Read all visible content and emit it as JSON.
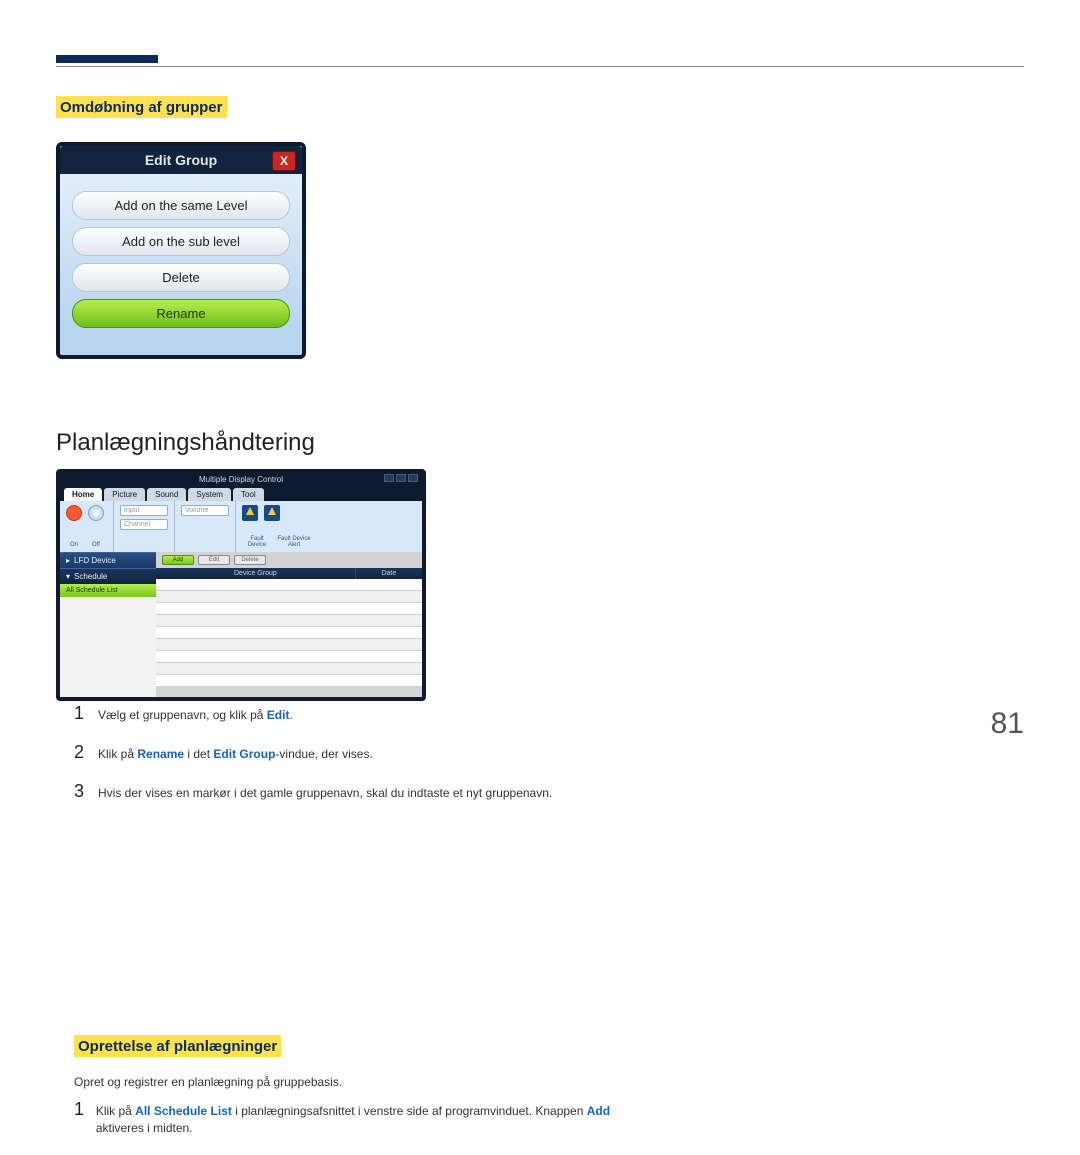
{
  "page_number": "81",
  "left": {
    "heading1": "Omdøbning af grupper",
    "dialog": {
      "title": "Edit Group",
      "close": "X",
      "options": [
        "Add on the same Level",
        "Add on the sub level",
        "Delete",
        "Rename"
      ],
      "active_index": 3
    },
    "heading2": "Planlægningshåndtering",
    "mdc": {
      "window_title": "Multiple Display Control",
      "tabs": [
        "Home",
        "Picture",
        "Sound",
        "System",
        "Tool"
      ],
      "power_label": "On",
      "refresh_label": "Off",
      "input_group": [
        "Input",
        "Channel"
      ],
      "volume_label": "Volume",
      "fault_labels": [
        "Fault Device",
        "Fault Device Alert"
      ],
      "side": {
        "header1": "LFD Device",
        "header2": "Schedule",
        "item": "All Schedule List"
      },
      "toolbar": [
        "Add",
        "Edit",
        "Delete"
      ],
      "grid_headers": [
        "Device Group",
        "Date"
      ]
    }
  },
  "right": {
    "steps1": [
      {
        "n": "1",
        "pre": "Vælg et gruppenavn, og klik på ",
        "kw": "Edit",
        "post": "."
      },
      {
        "n": "2",
        "pre": "Klik på ",
        "kw": "Rename",
        "mid": " i det ",
        "kw2": "Edit Group",
        "post": "-vindue, der vises."
      },
      {
        "n": "3",
        "pre": "Hvis der vises en markør i det gamle gruppenavn, skal du indtaste et nyt gruppenavn.",
        "kw": "",
        "post": ""
      }
    ],
    "heading3": "Oprettelse af planlægninger",
    "intro": "Opret og registrer en planlægning på gruppebasis.",
    "steps2": [
      {
        "n": "1",
        "pre": "Klik på ",
        "kw": "All Schedule List",
        "mid": " i planlægningsafsnittet i venstre side af programvinduet. Knappen ",
        "kw2": "Add",
        "post": " aktiveres i midten."
      }
    ]
  }
}
